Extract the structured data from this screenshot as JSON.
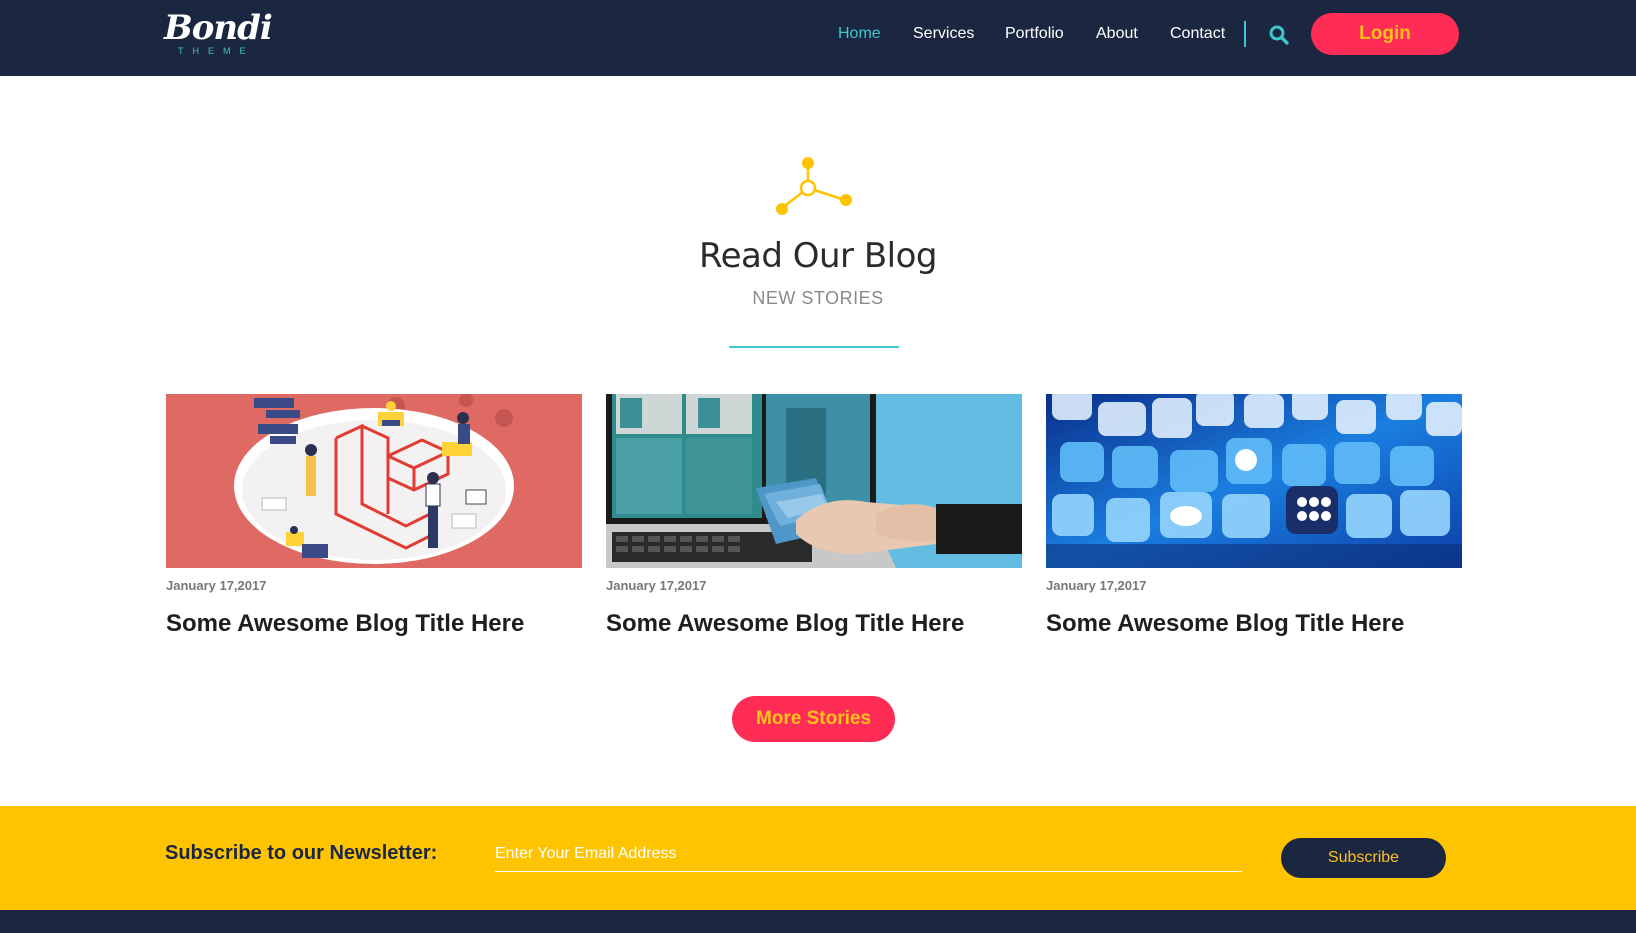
{
  "brand": {
    "name": "Bondi",
    "tagline": "THEME"
  },
  "nav": {
    "items": [
      {
        "label": "Home",
        "active": true
      },
      {
        "label": "Services",
        "active": false
      },
      {
        "label": "Portfolio",
        "active": false
      },
      {
        "label": "About",
        "active": false
      },
      {
        "label": "Contact",
        "active": false
      }
    ],
    "search_icon": "search-icon",
    "login_label": "Login"
  },
  "blog": {
    "icon": "molecule-icon",
    "title": "Read Our Blog",
    "subtitle": "NEW STORIES",
    "posts": [
      {
        "date": "January 17,2017",
        "title": "Some Awesome Blog Title Here",
        "image": "isometric-laravel-illustration"
      },
      {
        "date": "January 17,2017",
        "title": "Some Awesome Blog Title Here",
        "image": "designer-color-swatches-monitor"
      },
      {
        "date": "January 17,2017",
        "title": "Some Awesome Blog Title Here",
        "image": "social-media-app-icons"
      }
    ],
    "more_label": "More Stories"
  },
  "newsletter": {
    "label": "Subscribe to our Newsletter:",
    "placeholder": "Enter Your Email Address",
    "button_label": "Subscribe"
  },
  "colors": {
    "nav_bg": "#1b2640",
    "accent_teal": "#3ec7cd",
    "accent_pink": "#ff2d55",
    "accent_yellow": "#ffc400",
    "button_text": "#ffc21a"
  }
}
